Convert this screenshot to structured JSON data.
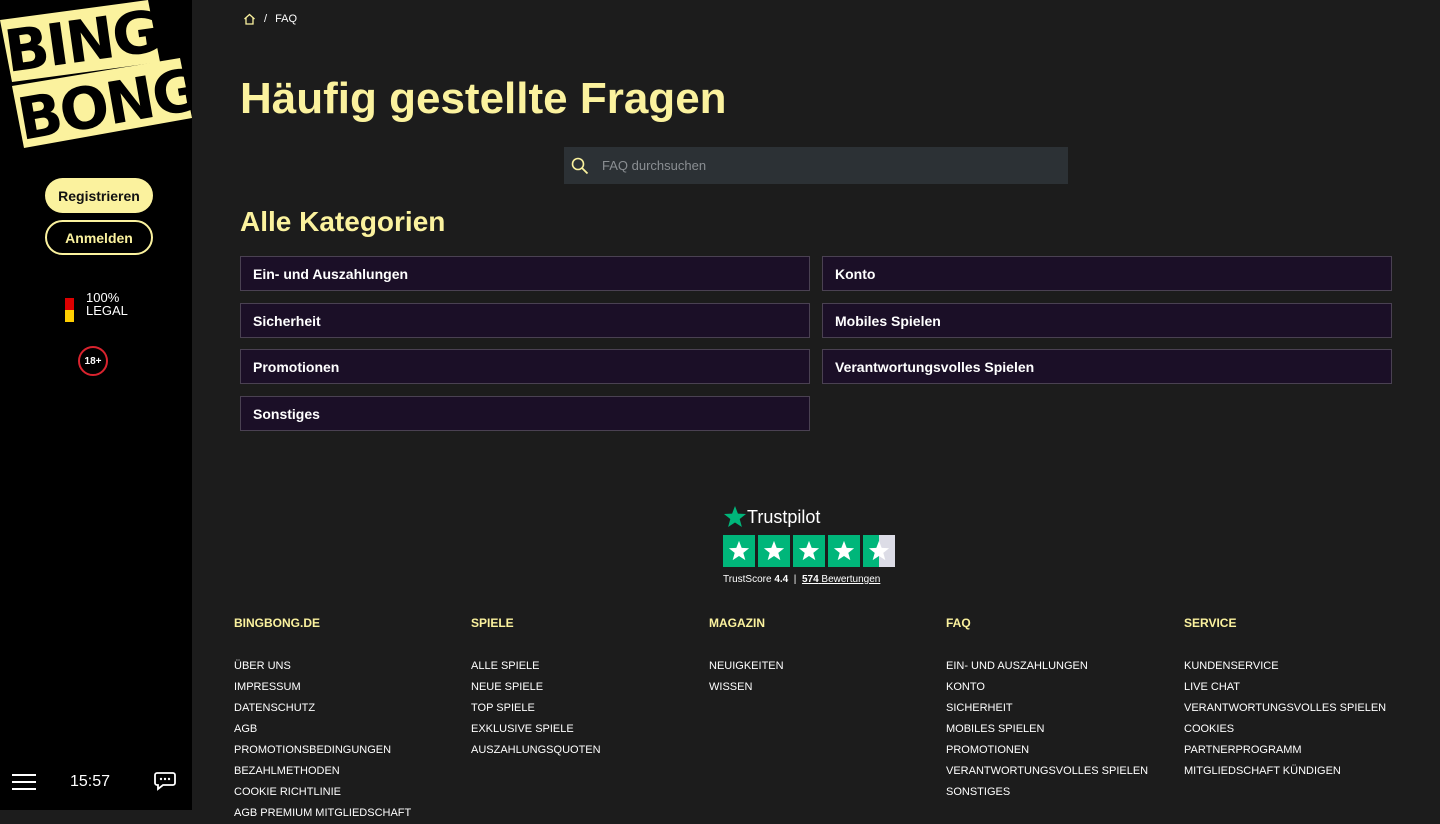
{
  "brand": {
    "logo_line1": "BING",
    "logo_line2": "BONG",
    "accent": "#fbf29e"
  },
  "sidebar": {
    "register_label": "Registrieren",
    "login_label": "Anmelden",
    "legal_percent": "100%",
    "legal_text": "LEGAL",
    "age_badge": "18+",
    "time": "15:57",
    "menu_icon": "hamburger-icon",
    "chat_icon": "chat-icon"
  },
  "breadcrumb": {
    "home_icon": "home-icon",
    "separator": "/",
    "current": "FAQ"
  },
  "page": {
    "title": "Häufig gestellte Fragen",
    "search_placeholder": "FAQ durchsuchen",
    "categories_title": "Alle Kategorien",
    "categories": [
      "Ein- und Auszahlungen",
      "Konto",
      "Sicherheit",
      "Mobiles Spielen",
      "Promotionen",
      "Verantwortungsvolles Spielen",
      "Sonstiges"
    ]
  },
  "trustpilot": {
    "name": "Trustpilot",
    "score_label": "TrustScore",
    "score": "4.4",
    "separator": "|",
    "reviews_count": "574",
    "reviews_label": "Bewertungen",
    "rating": 4.4,
    "brand_color": "#00b67a"
  },
  "footer": {
    "columns": [
      {
        "title": "BINGBONG.DE",
        "links": [
          "ÜBER UNS",
          "IMPRESSUM",
          "DATENSCHUTZ",
          "AGB",
          "PROMOTIONSBEDINGUNGEN",
          "BEZAHLMETHODEN",
          "COOKIE RICHTLINIE",
          "AGB PREMIUM MITGLIEDSCHAFT"
        ]
      },
      {
        "title": "SPIELE",
        "links": [
          "ALLE SPIELE",
          "NEUE SPIELE",
          "TOP SPIELE",
          "EXKLUSIVE SPIELE",
          "AUSZAHLUNGSQUOTEN"
        ]
      },
      {
        "title": "MAGAZIN",
        "links": [
          "NEUIGKEITEN",
          "WISSEN"
        ]
      },
      {
        "title": "FAQ",
        "links": [
          "EIN- UND AUSZAHLUNGEN",
          "KONTO",
          "SICHERHEIT",
          "MOBILES SPIELEN",
          "PROMOTIONEN",
          "VERANTWORTUNGSVOLLES SPIELEN",
          "SONSTIGES"
        ]
      },
      {
        "title": "SERVICE",
        "links": [
          "KUNDENSERVICE",
          "LIVE CHAT",
          "VERANTWORTUNGSVOLLES SPIELEN",
          "COOKIES",
          "PARTNERPROGRAMM",
          "MITGLIEDSCHAFT KÜNDIGEN"
        ]
      }
    ]
  }
}
